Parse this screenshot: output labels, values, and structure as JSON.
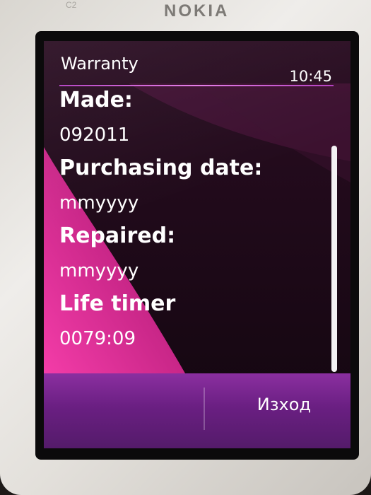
{
  "device": {
    "brand": "NOKIA",
    "model": "C2"
  },
  "status_bar": {
    "title": "Warranty",
    "time": "10:45"
  },
  "fields": [
    {
      "label": "Made:",
      "value": "092011"
    },
    {
      "label": "Purchasing date:",
      "value": "mmyyyy"
    },
    {
      "label": "Repaired:",
      "value": "mmyyyy"
    },
    {
      "label": "Life timer",
      "value": "0079:09"
    }
  ],
  "softkeys": {
    "right_label": "Изход"
  },
  "colors": {
    "accent": "#b23fc0",
    "wallpaper_pink": "#e0359e",
    "softkey_bar": "#6a1f82",
    "text": "#ffffff"
  },
  "scroll": {
    "position_fraction": 0.3
  }
}
